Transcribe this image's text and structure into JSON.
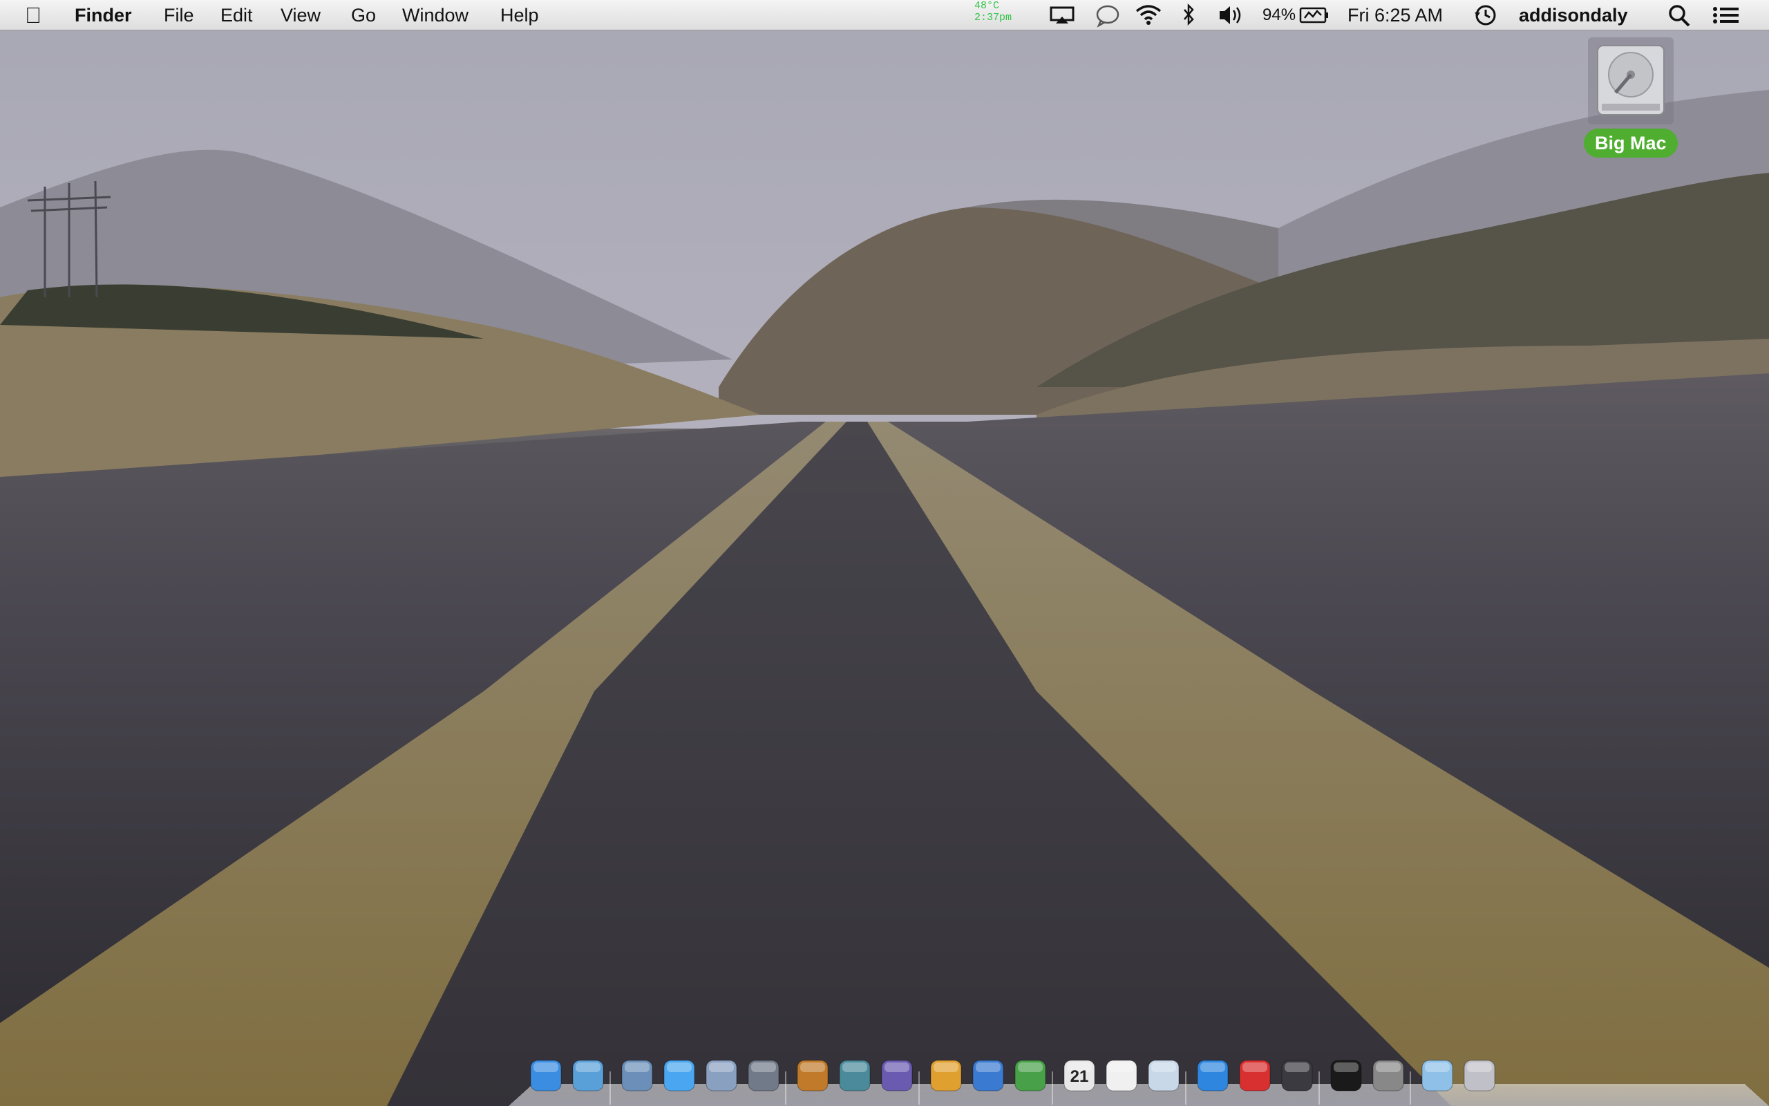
{
  "menubar": {
    "app_name": "Finder",
    "menus": [
      "File",
      "Edit",
      "View",
      "Go",
      "Window",
      "Help"
    ],
    "weather_temp": "48°C",
    "weather_time": "2:37pm",
    "battery": "94%",
    "clock": "Fri 6:25 AM",
    "user": "addisondaly",
    "icons": [
      "apple-icon",
      "airplay-icon",
      "messages-status-icon",
      "wifi-icon",
      "bluetooth-icon",
      "volume-icon",
      "battery-icon",
      "time-machine-icon",
      "spotlight-icon",
      "notification-center-icon"
    ]
  },
  "desktop": {
    "drive_label": "Big Mac",
    "drive_icon": "hard-drive-icon"
  },
  "dock": {
    "items": [
      {
        "icon": "finder-icon",
        "color": "#3a8de0"
      },
      {
        "icon": "itunes-icon",
        "color": "#5aa0d8"
      },
      {
        "sep": true
      },
      {
        "icon": "safari-icon",
        "color": "#6b8fb8"
      },
      {
        "icon": "messages-icon",
        "color": "#4aa6f0"
      },
      {
        "icon": "mail-icon",
        "color": "#8aa0c0"
      },
      {
        "icon": "facetime-icon",
        "color": "#707a88"
      },
      {
        "sep": true
      },
      {
        "icon": "garageband-icon",
        "color": "#c07a2a"
      },
      {
        "icon": "iphoto-icon",
        "color": "#4a8a9a"
      },
      {
        "icon": "imovie-icon",
        "color": "#6a5ab0"
      },
      {
        "sep": true
      },
      {
        "icon": "pages-icon",
        "color": "#e0a030"
      },
      {
        "icon": "keynote-icon",
        "color": "#3a7ad0"
      },
      {
        "icon": "numbers-icon",
        "color": "#48a048"
      },
      {
        "sep": true
      },
      {
        "icon": "calendar-icon",
        "color": "#e8e8e8",
        "label": "21"
      },
      {
        "icon": "reminders-icon",
        "color": "#f0f0f0"
      },
      {
        "icon": "preview-icon",
        "color": "#c8d8e8"
      },
      {
        "sep": true
      },
      {
        "icon": "app-store-icon",
        "color": "#2e86de"
      },
      {
        "icon": "game-center-icon",
        "color": "#d83030"
      },
      {
        "icon": "steam-icon",
        "color": "#3a3a40"
      },
      {
        "sep": true
      },
      {
        "icon": "terminal-icon",
        "color": "#1a1a1a"
      },
      {
        "icon": "system-preferences-icon",
        "color": "#888888"
      },
      {
        "sep": true
      },
      {
        "icon": "downloads-folder-icon",
        "color": "#8ec0e8"
      },
      {
        "icon": "trash-icon",
        "color": "#c0c0c8"
      }
    ]
  }
}
